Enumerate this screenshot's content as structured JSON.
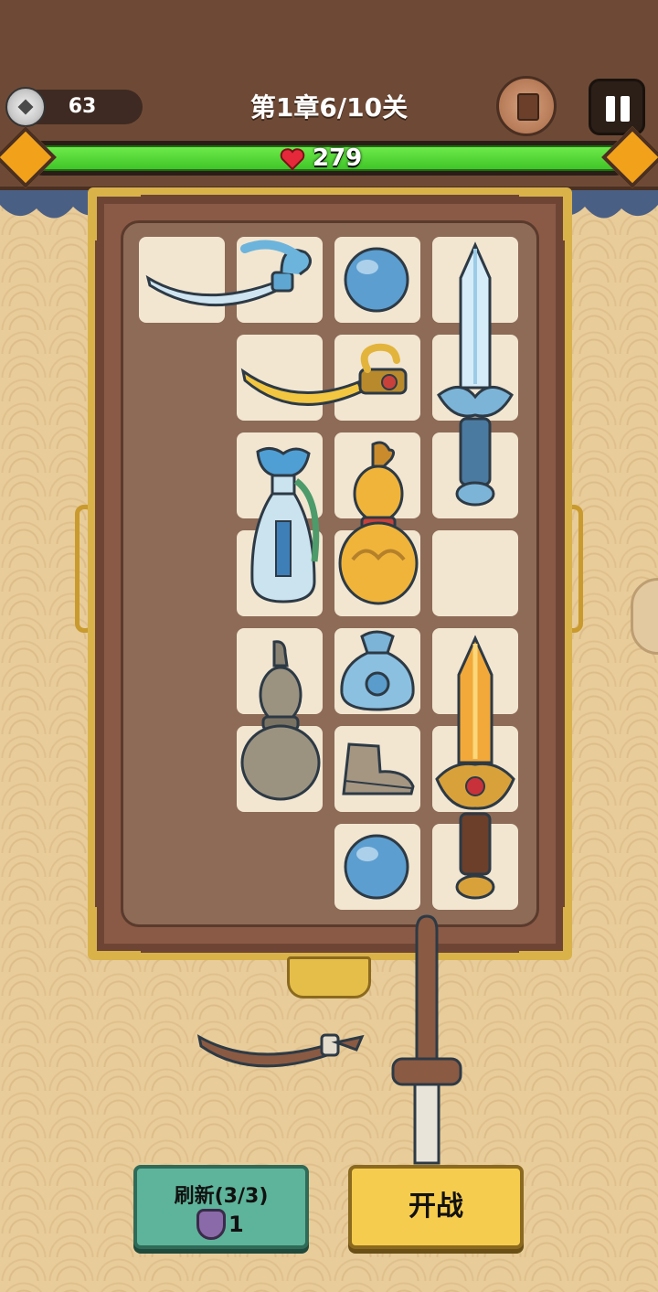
{
  "header": {
    "coins": "63",
    "level_title": "第1章6/10关",
    "hp": "279"
  },
  "buttons": {
    "refresh_label": "刷新(3/3)",
    "refresh_cost": "1",
    "fight_label": "开战"
  },
  "colors": {
    "hp_green": "#4fd534",
    "board_frame": "#d9b24a",
    "refresh_button": "#5eb49a",
    "fight_button": "#f6cc4e"
  },
  "board": {
    "items": [
      "ice-saber",
      "blue-orb",
      "ice-sword",
      "golden-saber",
      "water-vase",
      "golden-gourd",
      "gray-gourd",
      "blue-pouch",
      "cloth-boot",
      "blue-orb",
      "golden-sword"
    ]
  },
  "hand": {
    "items": [
      "wooden-saber",
      "wooden-sword"
    ]
  }
}
